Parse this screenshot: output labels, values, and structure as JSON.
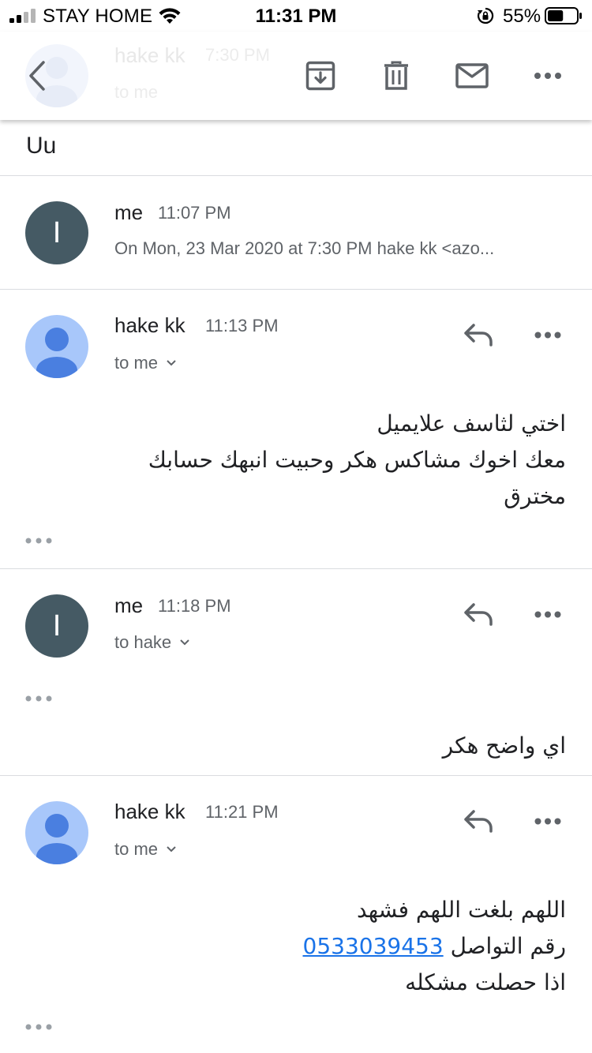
{
  "status_bar": {
    "carrier": "STAY HOME",
    "time": "11:31 PM",
    "battery_percent": "55%",
    "battery_level": 0.55,
    "icons": [
      "signal-icon",
      "wifi-icon",
      "orientation-lock-icon",
      "battery-icon"
    ]
  },
  "header": {
    "ghost_sender": "hake kk",
    "ghost_time": "7:30 PM",
    "ghost_recipient": "to me",
    "icons": [
      "back-arrow-icon",
      "archive-icon",
      "trash-icon",
      "mail-icon",
      "more-icon"
    ]
  },
  "subject": "Uu",
  "messages": [
    {
      "sender": "me",
      "avatar_letter": "I",
      "time": "11:07 PM",
      "snippet": "On Mon, 23 Mar 2020 at 7:30 PM hake kk <azo..."
    },
    {
      "sender": "hake kk",
      "time": "11:13 PM",
      "recipient": "to me",
      "body": [
        "اختي لثاسف علايميل",
        "معك اخوك مشاكس هكر وحبيت انبهك حسابك",
        "مخترق"
      ]
    },
    {
      "sender": "me",
      "avatar_letter": "I",
      "time": "11:18 PM",
      "recipient": "to hake",
      "body": [
        "اي واضح هكر"
      ]
    },
    {
      "sender": "hake kk",
      "time": "11:21 PM",
      "recipient": "to me",
      "body_line1": "اللهم بلغت اللهم فشهد",
      "body_line2_text": "رقم التواصل",
      "phone": "0533039453",
      "body_line3": "اذا حصلت مشكله"
    }
  ],
  "colors": {
    "me_avatar": "#455a64",
    "person_avatar_bg": "#a8c7fa",
    "person_avatar_fg": "#4a7fe0",
    "link": "#1a73e8",
    "secondary_text": "#5f6368"
  }
}
